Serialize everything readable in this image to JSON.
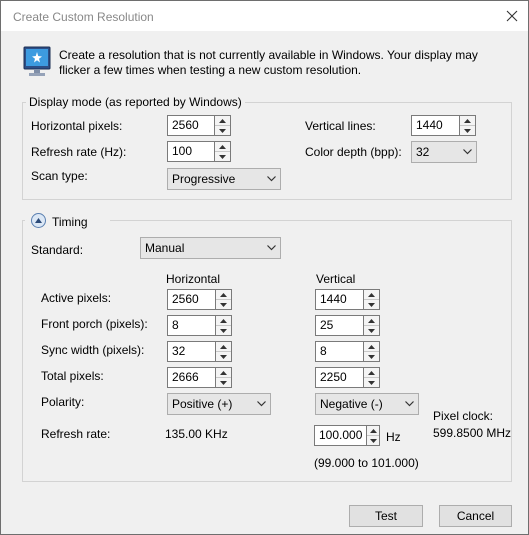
{
  "window": {
    "title": "Create Custom Resolution"
  },
  "intro": {
    "text": "Create a resolution that is not currently available in Windows. Your display may flicker a few times when testing a new custom resolution."
  },
  "display_mode": {
    "legend": "Display mode (as reported by Windows)",
    "horizontal_pixels": {
      "label": "Horizontal pixels:",
      "value": "2560"
    },
    "vertical_lines": {
      "label": "Vertical lines:",
      "value": "1440"
    },
    "refresh_rate": {
      "label": "Refresh rate (Hz):",
      "value": "100"
    },
    "color_depth": {
      "label": "Color depth (bpp):",
      "value": "32"
    },
    "scan_type": {
      "label": "Scan type:",
      "value": "Progressive"
    }
  },
  "timing": {
    "legend": "Timing",
    "standard": {
      "label": "Standard:",
      "value": "Manual"
    },
    "col_horizontal": "Horizontal",
    "col_vertical": "Vertical",
    "active_pixels": {
      "label": "Active pixels:",
      "h": "2560",
      "v": "1440"
    },
    "front_porch": {
      "label": "Front porch (pixels):",
      "h": "8",
      "v": "25"
    },
    "sync_width": {
      "label": "Sync width (pixels):",
      "h": "32",
      "v": "8"
    },
    "total_pixels": {
      "label": "Total pixels:",
      "h": "2666",
      "v": "2250"
    },
    "polarity": {
      "label": "Polarity:",
      "h": "Positive (+)",
      "v": "Negative (-)"
    },
    "refresh_rate": {
      "label": "Refresh rate:",
      "h": "135.00 KHz",
      "v": "100.000",
      "unit": "Hz",
      "range": "(99.000 to 101.000)"
    },
    "pixel_clock": {
      "label": "Pixel clock:",
      "value": "599.8500 MHz"
    }
  },
  "buttons": {
    "test": "Test",
    "cancel": "Cancel"
  }
}
